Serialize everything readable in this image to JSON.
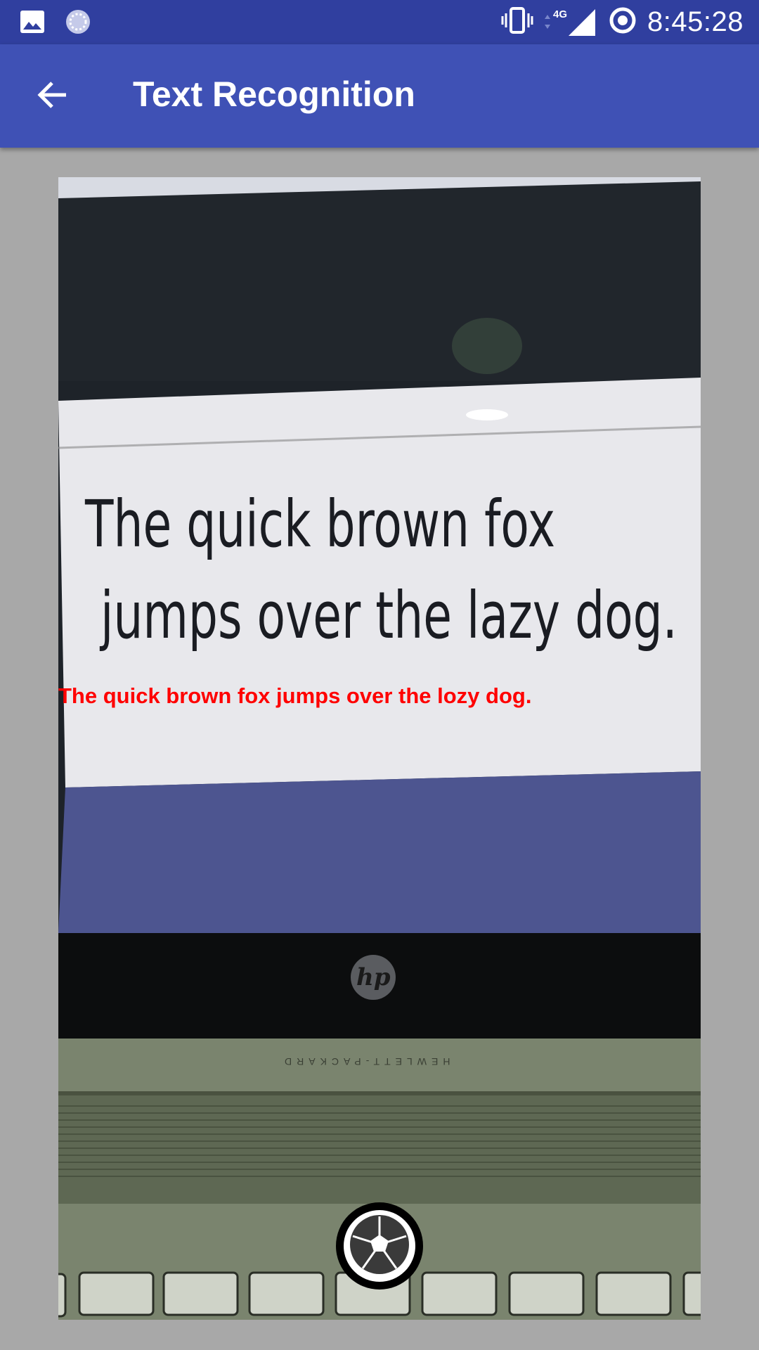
{
  "status_bar": {
    "time": "8:45:28",
    "network_type": "4G",
    "icons": [
      "image-icon",
      "sync-icon",
      "vibrate-icon",
      "data-arrows-icon",
      "signal-icon",
      "data-saver-icon"
    ]
  },
  "app_bar": {
    "title": "Text Recognition",
    "back_icon": "arrow-back-icon"
  },
  "camera": {
    "recognized_text": "The quick brown fox jumps over the lozy dog.",
    "screen_text_line1": "The quick brown fox",
    "screen_text_line2": "jumps over the lazy dog.",
    "laptop_brand_logo": "hp",
    "laptop_brand_text": "HEWLETT-PACKARD",
    "overlay_color": "#ff0000"
  },
  "shutter": {
    "icon": "camera-shutter-icon"
  },
  "colors": {
    "status_bar": "#303f9f",
    "app_bar": "#3f51b5",
    "background": "#a8a8a8"
  }
}
